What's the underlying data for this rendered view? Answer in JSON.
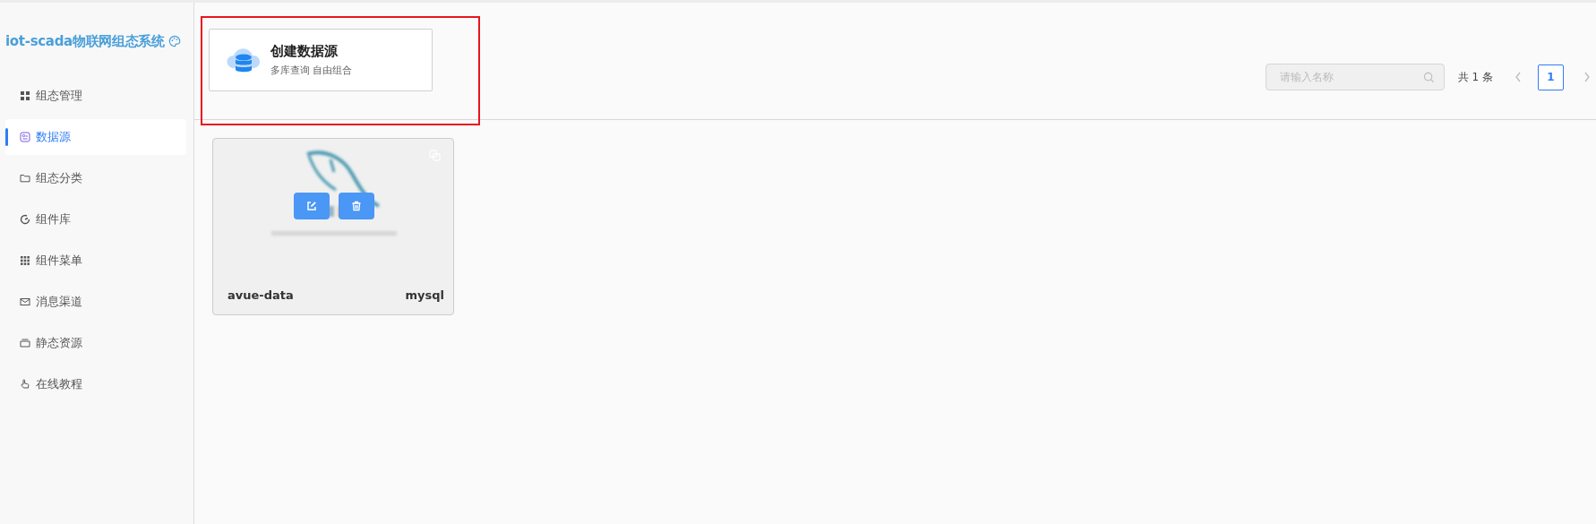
{
  "sidebar": {
    "title": "iot-scada物联网组态系统",
    "items": [
      {
        "label": "组态管理",
        "kind": "grid",
        "selected": false
      },
      {
        "label": "数据源",
        "kind": "source",
        "selected": true
      },
      {
        "label": "组态分类",
        "kind": "folder",
        "selected": false
      },
      {
        "label": "组件库",
        "kind": "gauge",
        "selected": false
      },
      {
        "label": "组件菜单",
        "kind": "dots",
        "selected": false
      },
      {
        "label": "消息渠道",
        "kind": "mail",
        "selected": false
      },
      {
        "label": "静态资源",
        "kind": "box",
        "selected": false
      },
      {
        "label": "在线教程",
        "kind": "hand",
        "selected": false
      }
    ]
  },
  "create_card": {
    "title": "创建数据源",
    "subtitle": "多库查询 自由组合"
  },
  "search": {
    "placeholder": "请输入名称"
  },
  "pagination": {
    "total": "共 1 条",
    "pages": [
      {
        "label": "1",
        "selected": true
      }
    ]
  },
  "datasources": [
    {
      "name": "avue-data",
      "type": "mysql"
    }
  ]
}
